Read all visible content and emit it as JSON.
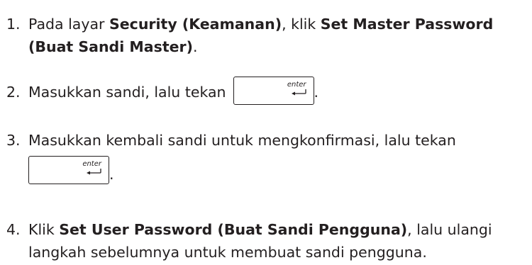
{
  "steps": [
    {
      "number": "1.",
      "part1": "Pada layar ",
      "bold1": "Security (Keamanan)",
      "part2": ", klik ",
      "bold2": "Set Master Password",
      "bold3": "(Buat Sandi Master)",
      "part3": "."
    },
    {
      "number": "2.",
      "text": "Masukkan sandi, lalu tekan",
      "after_key": "."
    },
    {
      "number": "3.",
      "text": "Masukkan kembali sandi untuk mengkonfirmasi, lalu tekan",
      "after_key": "."
    },
    {
      "number": "4.",
      "part1": "Klik ",
      "bold1": "Set User Password (Buat Sandi Pengguna)",
      "part2": ", lalu ulangi",
      "part3": "langkah sebelumnya untuk membuat sandi pengguna."
    }
  ],
  "enter_key": {
    "label": "enter",
    "icon": "enter-arrow-icon"
  }
}
